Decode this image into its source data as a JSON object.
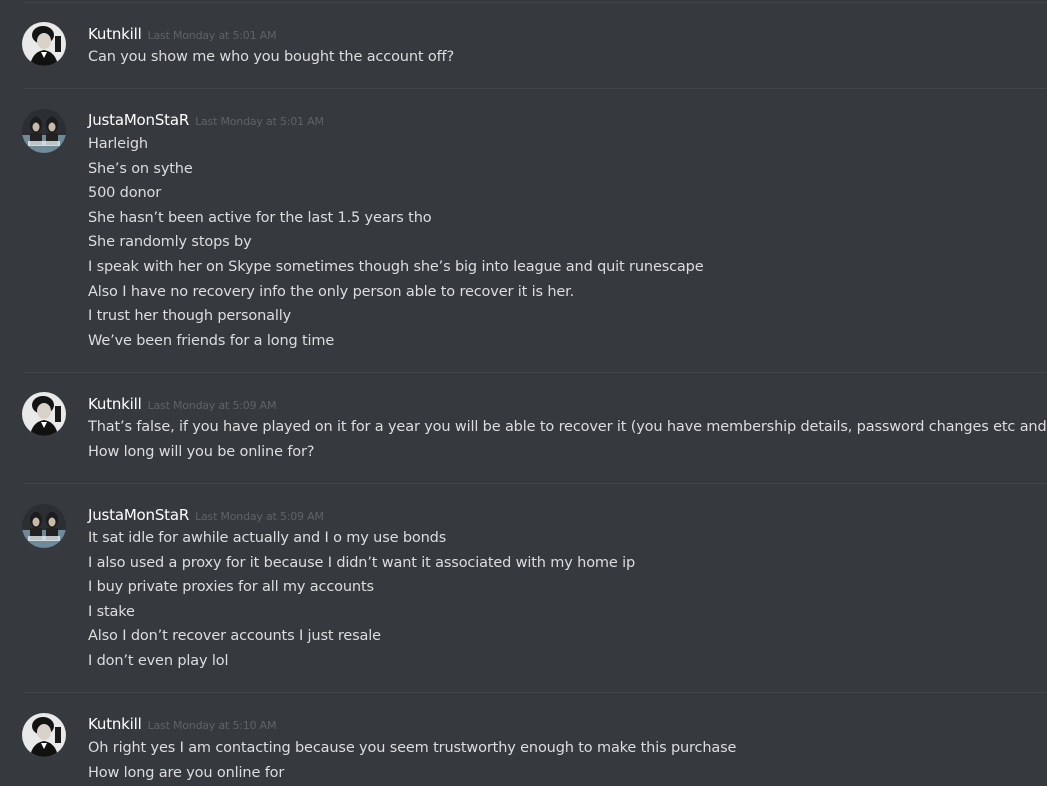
{
  "messages": [
    {
      "username": "Kutnkill",
      "timestamp": "Last Monday at 5:01 AM",
      "avatar": "kutnkill-avatar",
      "lines": [
        "Can you show me who you bought the account off?"
      ]
    },
    {
      "username": "JustaMonStaR",
      "timestamp": "Last Monday at 5:01 AM",
      "avatar": "justamonstar-avatar",
      "lines": [
        "Harleigh",
        "She’s on sythe",
        "500 donor",
        "She hasn’t been active for the last 1.5 years tho",
        "She randomly stops by",
        "I speak with her on Skype sometimes though she’s big into league and quit runescape",
        "Also I have no recovery info the only person able to recover it is her.",
        "I trust her though personally",
        "We’ve been friends for a long time"
      ]
    },
    {
      "username": "Kutnkill",
      "timestamp": "Last Monday at 5:09 AM",
      "avatar": "kutnkill-avatar",
      "lines": [
        "That’s false, if you have played on it for a year you will be able to recover it (you have membership details, password changes etc and mo",
        "How long will you be online for?"
      ]
    },
    {
      "username": "JustaMonStaR",
      "timestamp": "Last Monday at 5:09 AM",
      "avatar": "justamonstar-avatar",
      "lines": [
        "It sat idle for awhile actually and I o my use bonds",
        "I also used a proxy for it because I didn’t want it associated with my home ip",
        "I buy private proxies for all my accounts",
        "I stake",
        "Also I don’t recover accounts I just resale",
        "I don’t even play lol"
      ]
    },
    {
      "username": "Kutnkill",
      "timestamp": "Last Monday at 5:10 AM",
      "avatar": "kutnkill-avatar",
      "lines": [
        "Oh right yes I am contacting because you seem trustworthy enough to make this purchase",
        "How long are you online for"
      ]
    }
  ]
}
